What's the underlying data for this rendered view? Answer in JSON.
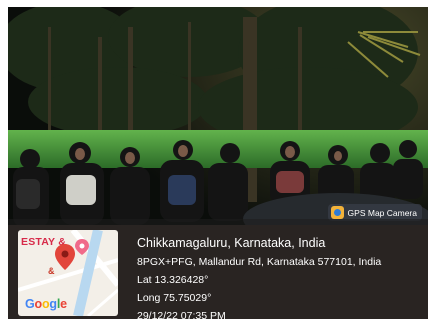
{
  "badge": {
    "label": "GPS Map Camera",
    "icon": "gps-map-camera-icon"
  },
  "map": {
    "poi_label": "ESTAY &",
    "poi_amp": "&",
    "attribution": "Google",
    "pin_icon": "location-pin-icon"
  },
  "location": {
    "city": "Chikkamagaluru, Karnataka, India",
    "address": "8PGX+PFG, Mallandur Rd, Karnataka 577101, India",
    "lat": "Lat 13.326428°",
    "long": "Long 75.75029°",
    "datetime": "29/12/22 07:35 PM"
  },
  "colors": {
    "info_panel": "rgba(30,30,30,0.58)",
    "pin": "#e2453b",
    "hedge": "#3f8c3a"
  }
}
